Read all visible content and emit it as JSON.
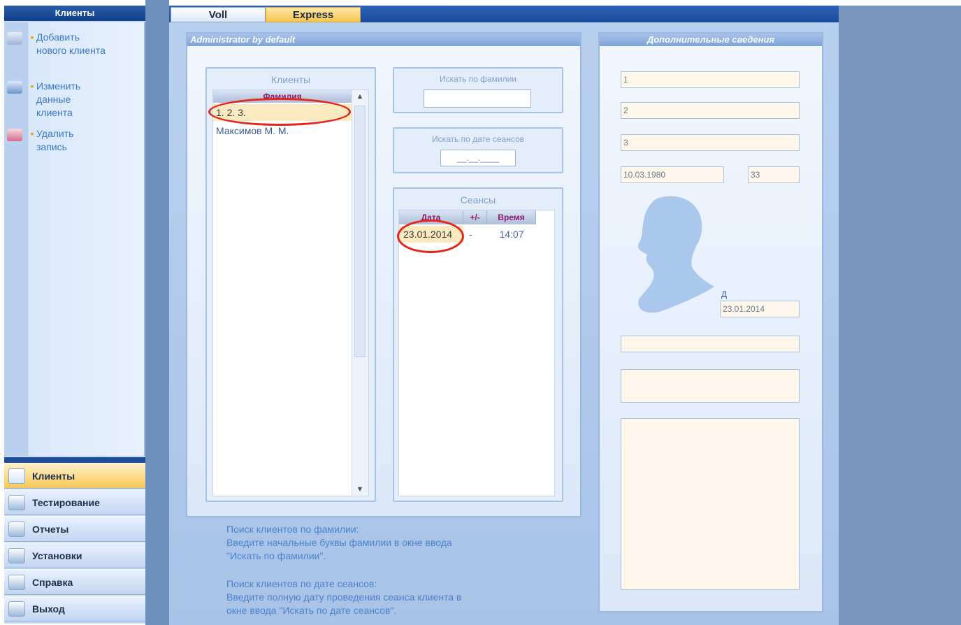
{
  "left_nav": {
    "header": "Клиенты",
    "tasks": [
      {
        "icon": "add-user-icon",
        "label": "Добавить нового клиента"
      },
      {
        "icon": "edit-user-icon",
        "label": "Изменить данные клиента"
      },
      {
        "icon": "delete-record-icon",
        "label": "Удалить запись"
      }
    ],
    "buttons": [
      {
        "icon": "clients-icon",
        "label": "Клиенты",
        "active": true
      },
      {
        "icon": "testing-icon",
        "label": "Тестирование",
        "active": false
      },
      {
        "icon": "reports-icon",
        "label": "Отчеты",
        "active": false
      },
      {
        "icon": "settings-icon",
        "label": "Установки",
        "active": false
      },
      {
        "icon": "help-icon",
        "label": "Справка",
        "active": false
      },
      {
        "icon": "exit-icon",
        "label": "Выход",
        "active": false
      }
    ]
  },
  "tabs": [
    {
      "label": "Voll"
    },
    {
      "label": "Express"
    }
  ],
  "admin": {
    "title": "Administrator by default",
    "clients": {
      "title": "Клиенты",
      "column": "Фамилия",
      "rows": [
        "1. 2. 3.",
        "Максимов М. М."
      ]
    },
    "search_name": {
      "title": "Искать по фамилии",
      "value": ""
    },
    "search_date": {
      "title": "Искать по дате сеансов",
      "placeholder": "__.__.____"
    },
    "sessions": {
      "title": "Сеансы",
      "columns": [
        "Дата",
        "+/-",
        "Время"
      ],
      "rows": [
        {
          "date": "23.01.2014",
          "pm": "-",
          "time": "14:07"
        }
      ]
    }
  },
  "info": {
    "title": "Дополнительные сведения",
    "fields": [
      "1",
      "2",
      "3"
    ],
    "birthdate": "10.03.1980",
    "age": "33",
    "d_label": "Д",
    "date": "23.01.2014"
  },
  "help": {
    "block1": [
      "Поиск клиентов по фамилии:",
      "Введите начальные буквы фамилии в окне ввода",
      "\"Искать по фамилии\"."
    ],
    "block2": [
      "Поиск клиентов по дате сеансов:",
      "Введите полную дату проведения сеанса клиента в",
      "окне ввода \"Искать по дате сеансов\"."
    ]
  },
  "colors": {
    "accent": "#f6c54c",
    "brand": "#1a4a98",
    "annotation": "#e8231a"
  }
}
